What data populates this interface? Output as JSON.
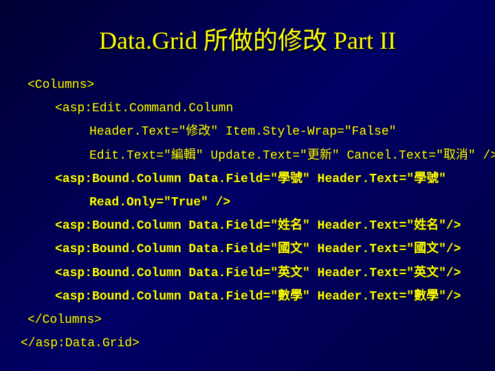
{
  "title": "Data.Grid 所做的修改 Part II",
  "lines": {
    "l0": "<Columns>",
    "l1": "<asp:Edit.Command.Column",
    "l2": "Header.Text=\"修改\" Item.Style-Wrap=\"False\"",
    "l3": "Edit.Text=\"編輯\" Update.Text=\"更新\" Cancel.Text=\"取消\" />",
    "l4": "<asp:Bound.Column Data.Field=\"學號\" Header.Text=\"學號\"",
    "l5": "Read.Only=\"True\" />",
    "l6": "<asp:Bound.Column Data.Field=\"姓名\" Header.Text=\"姓名\"/>",
    "l7": "<asp:Bound.Column Data.Field=\"國文\" Header.Text=\"國文\"/>",
    "l8": "<asp:Bound.Column Data.Field=\"英文\" Header.Text=\"英文\"/>",
    "l9": "<asp:Bound.Column Data.Field=\"數學\" Header.Text=\"數學\"/>",
    "l10": "</Columns>",
    "l11": "</asp:Data.Grid>"
  }
}
